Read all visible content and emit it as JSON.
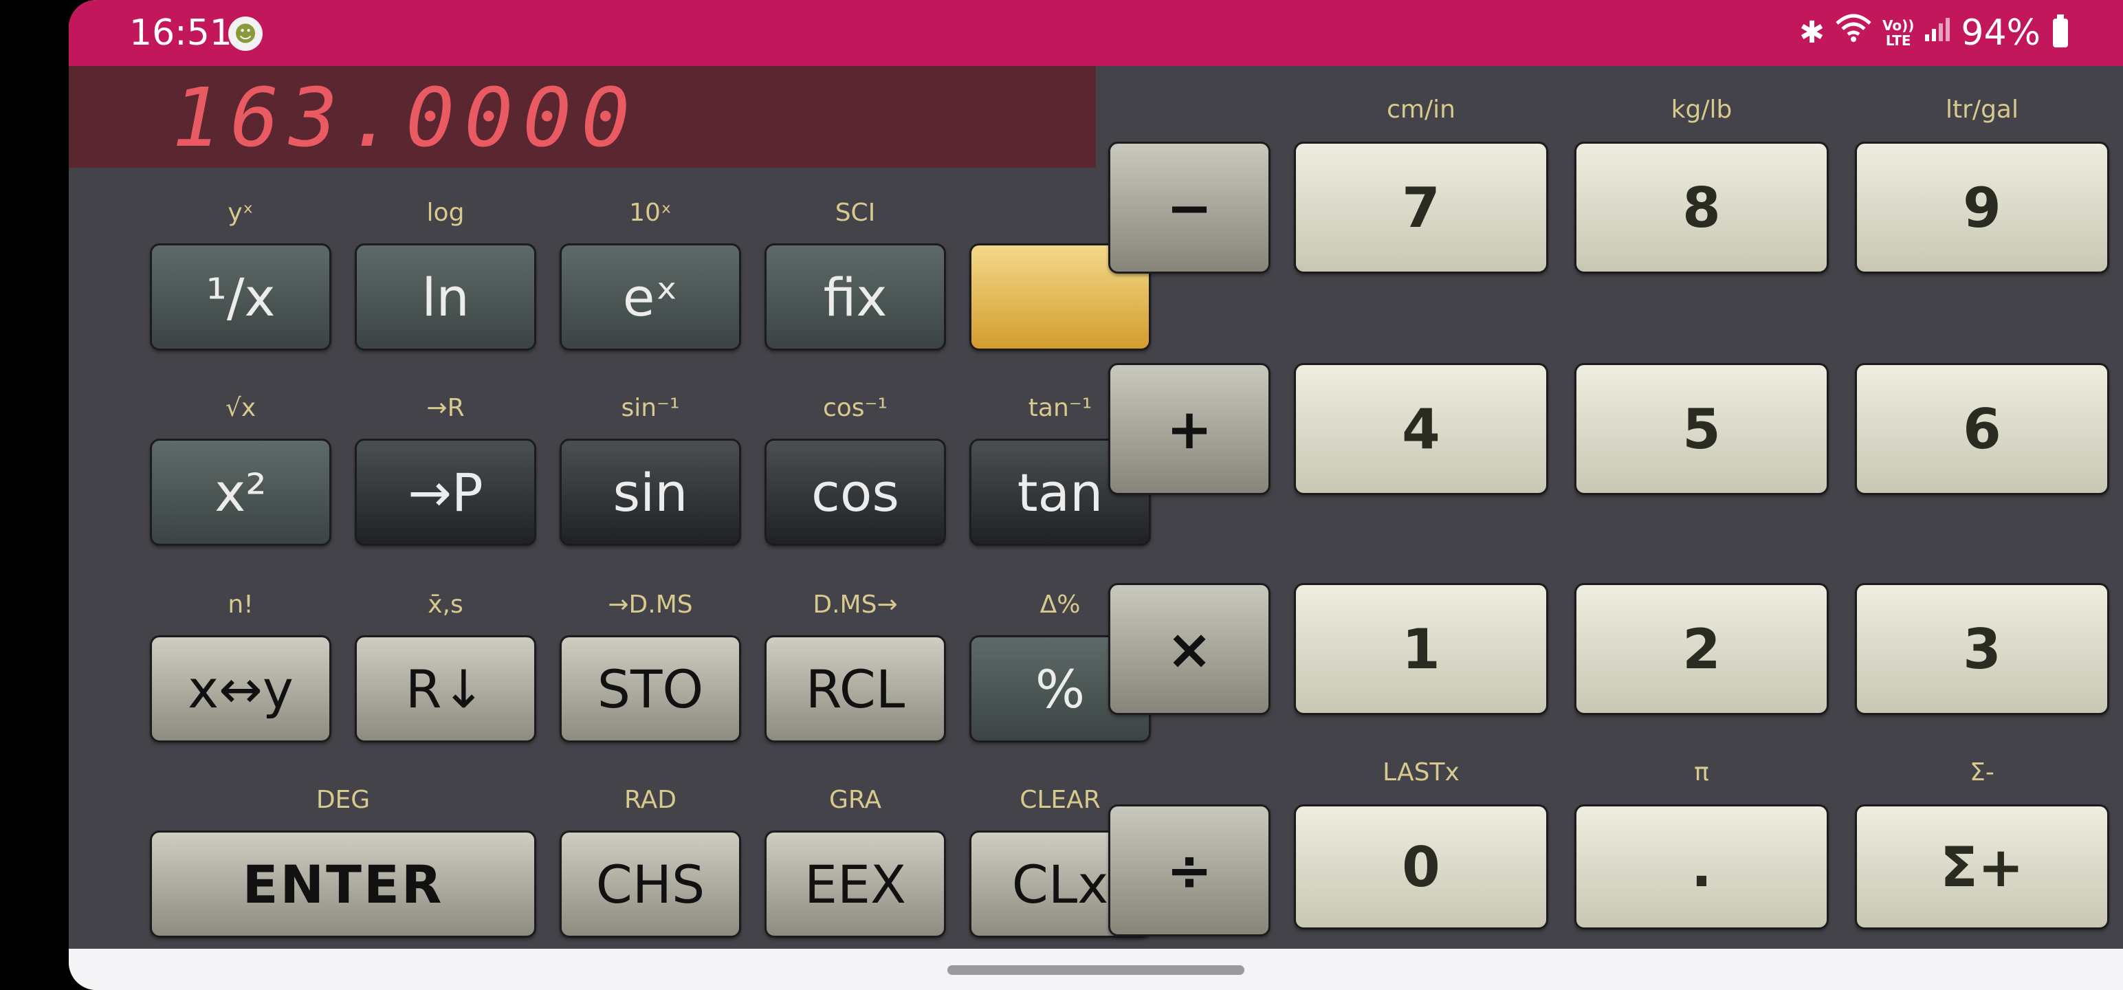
{
  "status_bar": {
    "time": "16:51",
    "android_icon": "android-icon",
    "battery": "94%",
    "volte": "Vo))\nLTE",
    "icons": [
      "bluetooth-icon",
      "wifi-icon",
      "volte-icon",
      "signal-icon",
      "battery-icon"
    ]
  },
  "display": {
    "value": "163.0000"
  },
  "keys": {
    "recip": {
      "label": "¹/x",
      "shift": "yˣ"
    },
    "ln": {
      "label": "ln",
      "shift": "log"
    },
    "ex": {
      "label": "eˣ",
      "shift": "10ˣ"
    },
    "fix": {
      "label": "fix",
      "shift": "SCI"
    },
    "gold": {
      "label": ""
    },
    "x2": {
      "label": "x²",
      "shift": "√x"
    },
    "toP": {
      "label": "→P",
      "shift": "→R"
    },
    "sin": {
      "label": "sin",
      "shift": "sin⁻¹"
    },
    "cos": {
      "label": "cos",
      "shift": "cos⁻¹"
    },
    "tan": {
      "label": "tan",
      "shift": "tan⁻¹"
    },
    "xy": {
      "label": "x↔y",
      "shift": "n!"
    },
    "rdown": {
      "label": "R↓",
      "shift": "x̄,s"
    },
    "sto": {
      "label": "STO",
      "shift": "→D.MS"
    },
    "rcl": {
      "label": "RCL",
      "shift": "D.MS→"
    },
    "pct": {
      "label": "%",
      "shift": "Δ%"
    },
    "enter": {
      "label": "ENTER",
      "shift": "DEG"
    },
    "chs": {
      "label": "CHS",
      "shift": "RAD"
    },
    "eex": {
      "label": "EEX",
      "shift": "GRA"
    },
    "clx": {
      "label": "CLx",
      "shift": "CLEAR"
    },
    "minus": {
      "label": "−"
    },
    "plus": {
      "label": "+"
    },
    "times": {
      "label": "×"
    },
    "divide": {
      "label": "÷"
    },
    "d7": {
      "label": "7",
      "shift": "cm/in"
    },
    "d8": {
      "label": "8",
      "shift": "kg/lb"
    },
    "d9": {
      "label": "9",
      "shift": "ltr/gal"
    },
    "d4": {
      "label": "4"
    },
    "d5": {
      "label": "5"
    },
    "d6": {
      "label": "6"
    },
    "d1": {
      "label": "1"
    },
    "d2": {
      "label": "2"
    },
    "d3": {
      "label": "3"
    },
    "d0": {
      "label": "0",
      "shift": "LASTx"
    },
    "dot": {
      "label": ".",
      "shift": "π"
    },
    "sigma": {
      "label": "Σ+",
      "shift": "Σ-"
    }
  },
  "colors": {
    "status_bar": "#c2185b",
    "display_bg": "#5a2731",
    "display_text": "#ea5a62",
    "panel_bg": "#434349",
    "shift_label": "#d8c98e",
    "gold_key": "#e2b54f"
  }
}
